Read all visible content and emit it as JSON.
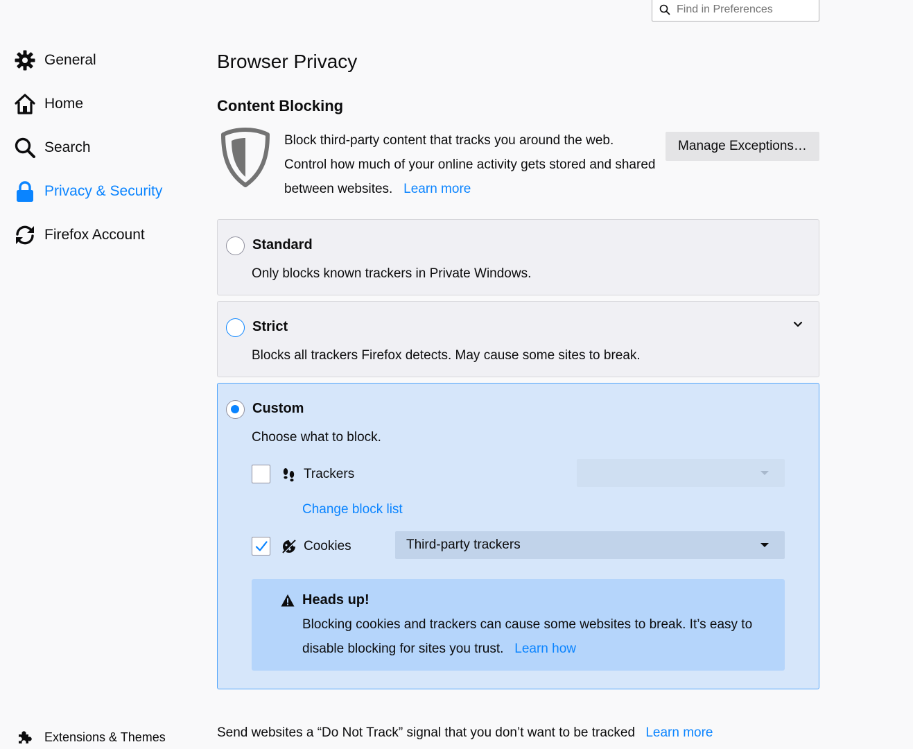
{
  "search": {
    "placeholder": "Find in Preferences"
  },
  "sidebar": {
    "items": [
      {
        "label": "General",
        "icon": "gear-icon"
      },
      {
        "label": "Home",
        "icon": "home-icon"
      },
      {
        "label": "Search",
        "icon": "search-icon"
      },
      {
        "label": "Privacy & Security",
        "icon": "lock-icon",
        "selected": true
      },
      {
        "label": "Firefox Account",
        "icon": "sync-icon"
      }
    ],
    "footer": {
      "label": "Extensions & Themes",
      "icon": "puzzle-icon"
    }
  },
  "main": {
    "title": "Browser Privacy",
    "content_blocking": {
      "heading": "Content Blocking",
      "description": "Block third-party content that tracks you around the web. Control how much of your online activity gets stored and shared between websites.",
      "learn_more": "Learn more",
      "manage_button": "Manage Exceptions…"
    },
    "options": {
      "standard": {
        "title": "Standard",
        "description": "Only blocks known trackers in Private Windows."
      },
      "strict": {
        "title": "Strict",
        "description": "Blocks all trackers Firefox detects. May cause some sites to break."
      },
      "custom": {
        "title": "Custom",
        "description": "Choose what to block.",
        "trackers_label": "Trackers",
        "trackers_checked": false,
        "change_block_list": "Change block list",
        "cookies_label": "Cookies",
        "cookies_checked": true,
        "cookies_select": "Third-party trackers"
      }
    },
    "warning": {
      "title": "Heads up!",
      "text": "Blocking cookies and trackers can cause some websites to break. It’s easy to disable blocking for sites you trust.",
      "link": "Learn how"
    },
    "dnt": {
      "text": "Send websites a “Do Not Track” signal that you don’t want to be tracked",
      "link": "Learn more"
    }
  },
  "colors": {
    "accent": "#0a84ff",
    "selected_panel": "#d6e6fa",
    "warning_bg": "#b5d5fb"
  }
}
